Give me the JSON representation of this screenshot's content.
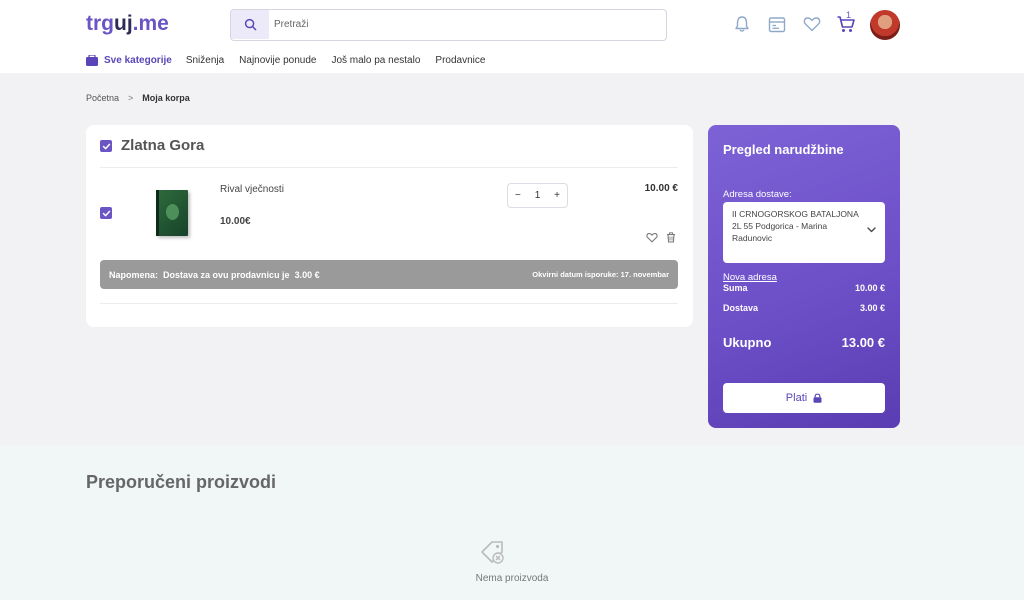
{
  "header": {
    "logo_part1": "trg",
    "logo_part2": "uj",
    "logo_part3": ".me",
    "search_placeholder": "Pretraži",
    "cart_count": "1",
    "icons": [
      "bell-icon",
      "calendar-icon",
      "heart-icon",
      "cart-icon"
    ]
  },
  "nav": {
    "categories": "Sve kategorije",
    "items": [
      "Sniženja",
      "Najnovije ponude",
      "Još malo pa nestalo",
      "Prodavnice"
    ]
  },
  "breadcrumb": {
    "home": "Početna",
    "separator": ">",
    "current": "Moja korpa"
  },
  "cart": {
    "store_name": "Zlatna Gora",
    "item": {
      "name": "Rival vječnosti",
      "unit_price": "10.00€",
      "quantity": "1",
      "price": "10.00 €"
    },
    "note_label": "Napomena:",
    "note_text": "Dostava za ovu prodavnicu je",
    "note_amount": "3.00 €",
    "delivery_date": "Okvirni datum isporuke: 17. novembar"
  },
  "summary": {
    "title": "Pregled narudžbine",
    "address_label": "Adresa dostave:",
    "address": "II CRNOGORSKOG BATALJONA 2L 55 Podgorica - Marina Radunovic",
    "new_address": "Nova adresa",
    "sum_label": "Suma",
    "sum_value": "10.00 €",
    "delivery_label": "Dostava",
    "delivery_value": "3.00 €",
    "total_label": "Ukupno",
    "total_value": "13.00 €",
    "pay_label": "Plati"
  },
  "recommended": {
    "title": "Preporučeni proizvodi",
    "empty": "Nema proizvoda"
  },
  "colors": {
    "accent": "#6b55c5",
    "summary_bg": "#6d4fc8",
    "note_bg": "#9a9a9a"
  }
}
